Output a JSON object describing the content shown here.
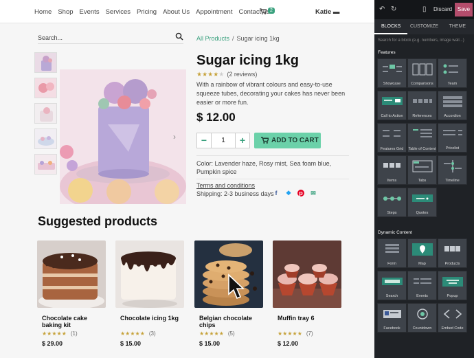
{
  "nav": {
    "links": [
      "Home",
      "Shop",
      "Events",
      "Services",
      "Pricing",
      "About Us",
      "Appointment",
      "Contact us"
    ],
    "cart_count": "2",
    "user": "Katie"
  },
  "search": {
    "placeholder": "Search..."
  },
  "breadcrumb": {
    "parent": "All Products",
    "current": "Sugar icing 1kg"
  },
  "product": {
    "title": "Sugar icing 1kg",
    "rating": 4,
    "reviews": "(2 reviews)",
    "description": "With a rainbow of vibrant colours and easy-to-use squeeze tubes, decorating your cakes has never been easier or more fun.",
    "price": "$ 12.00",
    "quantity": "1",
    "add_to_cart": "ADD TO CART",
    "color": "Color: Lavender haze, Rosy mist, Sea foam blue, Pumpkin spice",
    "terms": "Terms and conditions",
    "shipping": "Shipping: 2-3 business days"
  },
  "suggested": {
    "title": "Suggested products",
    "items": [
      {
        "name": "Chocolate cake baking kit",
        "reviews": "(1)",
        "price": "$ 29.00",
        "rating": 5
      },
      {
        "name": "Chocolate icing 1kg",
        "reviews": "(3)",
        "price": "$ 15.00",
        "rating": 5
      },
      {
        "name": "Belgian chocolate chips",
        "reviews": "(5)",
        "price": "$ 15.00",
        "rating": 5
      },
      {
        "name": "Muffin tray 6",
        "reviews": "(7)",
        "price": "$ 12.00",
        "rating": 5
      }
    ]
  },
  "editor": {
    "discard": "Discard",
    "save": "Save",
    "tabs": [
      "BLOCKS",
      "CUSTOMIZE",
      "THEME"
    ],
    "search_placeholder": "Search for a block (e.g. numbers, image wall...)",
    "features_title": "Features",
    "features": [
      "Showcase",
      "Comparisons",
      "Team",
      "Call to Action",
      "References",
      "Accordion",
      "Features Grid",
      "Table of Content",
      "Pricelist",
      "Items",
      "Tabs",
      "Timeline",
      "Steps",
      "Quotes"
    ],
    "dynamic_title": "Dynamic Content",
    "dynamic": [
      "Form",
      "Map",
      "Products",
      "Search",
      "Events",
      "Popup",
      "Facebook",
      "Countdown",
      "Embed Code"
    ]
  },
  "colors": {
    "accent": "#3aa17e",
    "cart_button": "#6bd1a9",
    "save": "#b44d6c",
    "panel": "#1f2226"
  }
}
